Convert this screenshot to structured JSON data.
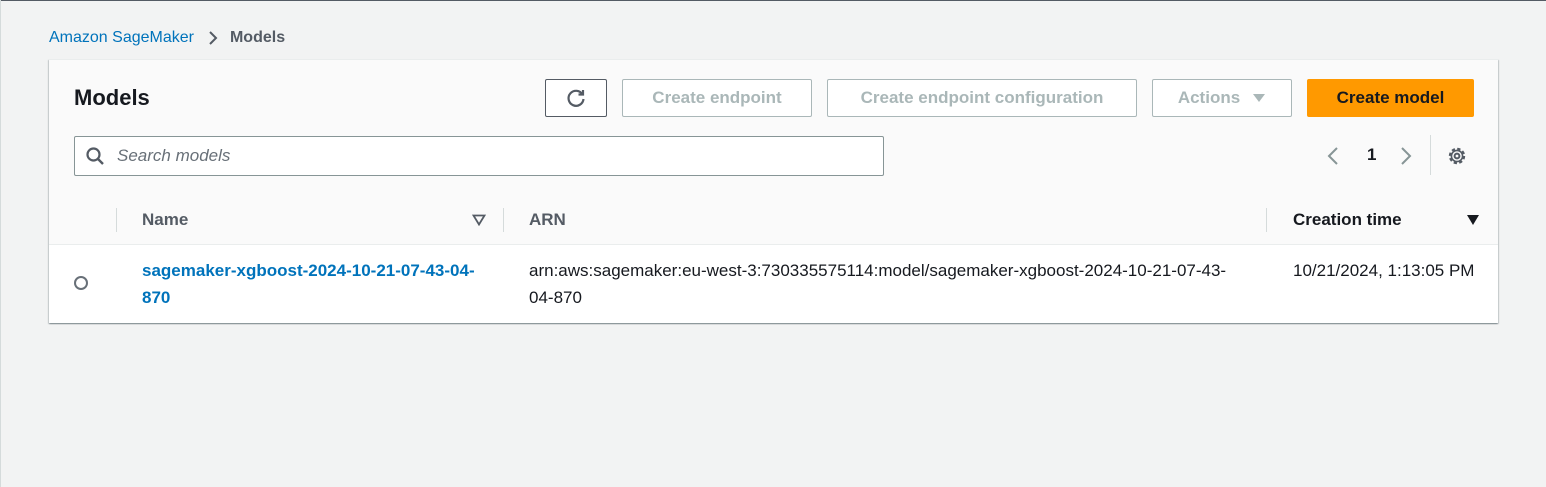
{
  "breadcrumb": {
    "root": "Amazon SageMaker",
    "current": "Models"
  },
  "panel": {
    "title": "Models",
    "buttons": {
      "refresh_icon": "refresh-icon",
      "create_endpoint": "Create endpoint",
      "create_endpoint_config": "Create endpoint configuration",
      "actions": "Actions",
      "create_model": "Create model"
    },
    "search": {
      "placeholder": "Search models",
      "value": ""
    },
    "pagination": {
      "current_page": "1"
    }
  },
  "table": {
    "columns": [
      "Name",
      "ARN",
      "Creation time"
    ],
    "rows": [
      {
        "name": "sagemaker-xgboost-2024-10-21-07-43-04-870",
        "arn": "arn:aws:sagemaker:eu-west-3:730335575114:model/sagemaker-xgboost-2024-10-21-07-43-04-870",
        "creation_time": "10/21/2024, 1:13:05 PM"
      }
    ]
  },
  "colors": {
    "link": "#0073bb",
    "primary_button": "#ff9900",
    "disabled_text": "#aab7b8",
    "background": "#f2f3f3"
  }
}
